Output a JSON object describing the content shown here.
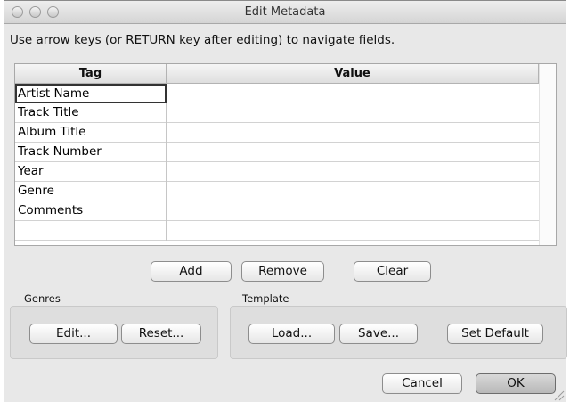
{
  "window": {
    "title": "Edit Metadata"
  },
  "instruction": "Use arrow keys (or RETURN key after editing) to navigate fields.",
  "table": {
    "columns": [
      "Tag",
      "Value"
    ],
    "rows": [
      {
        "tag": "Artist Name",
        "value": ""
      },
      {
        "tag": "Track Title",
        "value": ""
      },
      {
        "tag": "Album Title",
        "value": ""
      },
      {
        "tag": "Track Number",
        "value": ""
      },
      {
        "tag": "Year",
        "value": ""
      },
      {
        "tag": "Genre",
        "value": ""
      },
      {
        "tag": "Comments",
        "value": ""
      },
      {
        "tag": "",
        "value": ""
      }
    ]
  },
  "actions": {
    "add": "Add",
    "remove": "Remove",
    "clear": "Clear"
  },
  "genres": {
    "label": "Genres",
    "edit": "Edit...",
    "reset": "Reset..."
  },
  "template": {
    "label": "Template",
    "load": "Load...",
    "save": "Save...",
    "set_default": "Set Default"
  },
  "dialog": {
    "cancel": "Cancel",
    "ok": "OK"
  }
}
